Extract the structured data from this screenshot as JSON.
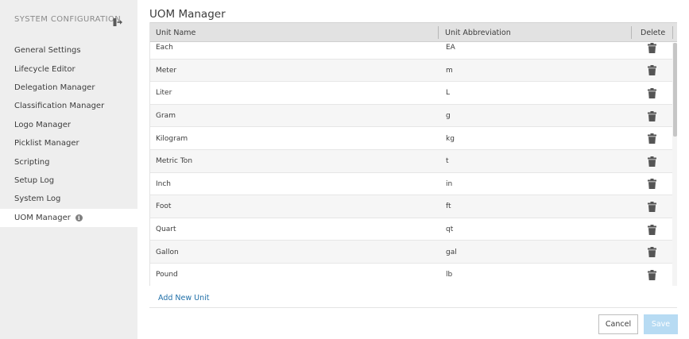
{
  "sidebar": {
    "title": "SYSTEM CONFIGURATION",
    "items": [
      {
        "label": "General Settings"
      },
      {
        "label": "Lifecycle Editor"
      },
      {
        "label": "Delegation Manager"
      },
      {
        "label": "Classification Manager"
      },
      {
        "label": "Logo Manager"
      },
      {
        "label": "Picklist Manager"
      },
      {
        "label": "Scripting"
      },
      {
        "label": "Setup Log"
      },
      {
        "label": "System Log"
      },
      {
        "label": "UOM Manager",
        "active": true
      }
    ]
  },
  "main": {
    "title": "UOM Manager",
    "table": {
      "headers": {
        "name": "Unit Name",
        "abbreviation": "Unit Abbreviation",
        "delete": "Delete"
      },
      "rows": [
        {
          "name": "Each",
          "abbreviation": "EA"
        },
        {
          "name": "Meter",
          "abbreviation": "m"
        },
        {
          "name": "Liter",
          "abbreviation": "L"
        },
        {
          "name": "Gram",
          "abbreviation": "g"
        },
        {
          "name": "Kilogram",
          "abbreviation": "kg"
        },
        {
          "name": "Metric Ton",
          "abbreviation": "t"
        },
        {
          "name": "Inch",
          "abbreviation": "in"
        },
        {
          "name": "Foot",
          "abbreviation": "ft"
        },
        {
          "name": "Quart",
          "abbreviation": "qt"
        },
        {
          "name": "Gallon",
          "abbreviation": "gal"
        },
        {
          "name": "Pound",
          "abbreviation": "lb"
        }
      ]
    },
    "add_label": "Add New Unit",
    "cancel_label": "Cancel",
    "save_label": "Save"
  },
  "icons": {
    "collapse": "collapse-panel-icon",
    "info": "info-icon",
    "delete": "trash-icon"
  },
  "colors": {
    "link": "#1f6fa8",
    "save_disabled": "#b7dbf3",
    "sidebar_bg": "#eeeeee",
    "header_bg": "#e2e2e2"
  }
}
